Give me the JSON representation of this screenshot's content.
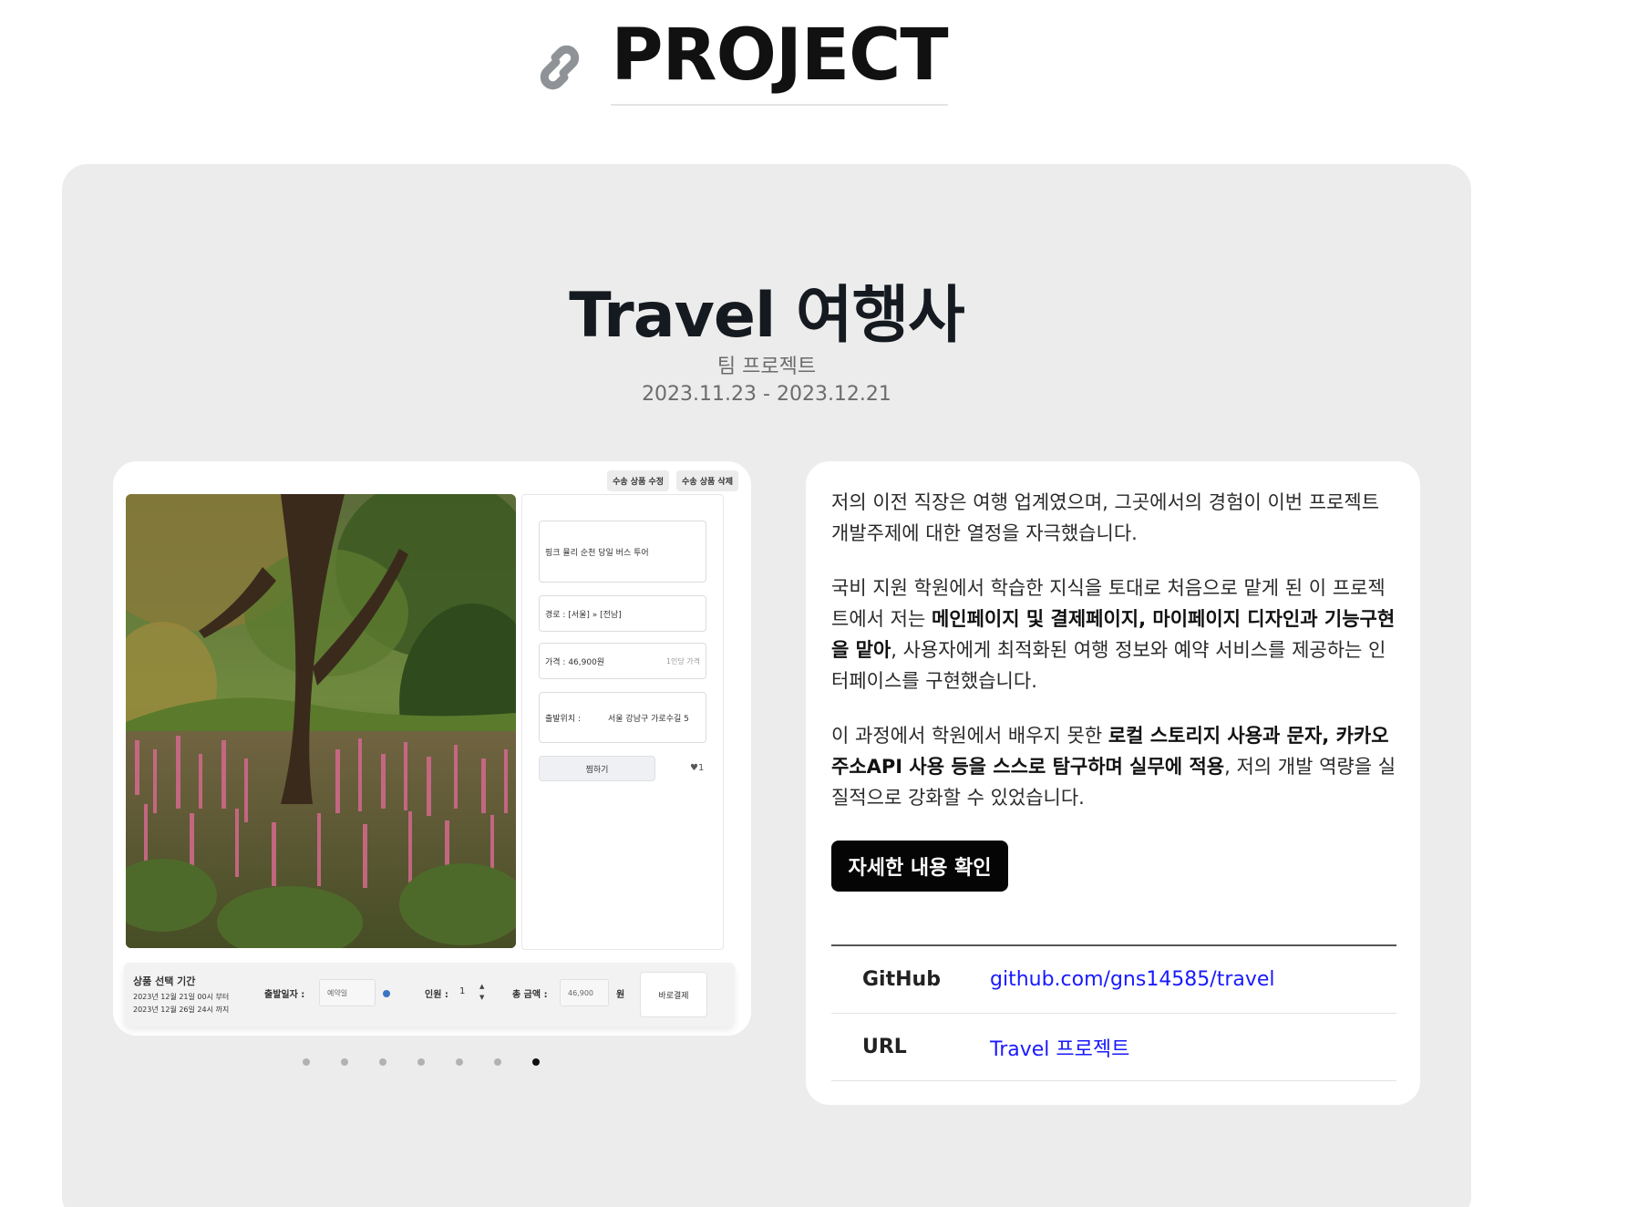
{
  "section": {
    "title": "PROJECT",
    "icon": "link-icon"
  },
  "project": {
    "title": "Travel 여행사",
    "kind": "팀 프로젝트",
    "period": "2023.11.23 - 2023.12.21"
  },
  "screenshot": {
    "top_buttons": [
      "수송 상품 수정",
      "수송 상품 삭제"
    ],
    "form": {
      "product_name": "핑크 뮬리 순천 당일 버스 투어",
      "route": "경로 : [서울] » [전남]",
      "price": "가격 : 46,900원",
      "price_hint": "1인당 가격",
      "departure_location_label": "출발위치 :",
      "departure_location_value": "서울 강남구 가로수길 5",
      "like_button": "찜하기",
      "like_count": "♥1"
    },
    "booking_bar": {
      "period_title": "상품 선택 기간",
      "period_start": "2023년 12월 21일 00시 부터",
      "period_end": "2023년 12월 26일 24시 까지",
      "date_label": "출발일자 :",
      "date_placeholder": "예약일",
      "people_label": "인원 :",
      "people_value": "1",
      "stepper_up": "▲",
      "stepper_down": "▼",
      "total_label": "총 금액 :",
      "total_value": "46,900",
      "currency": "원",
      "buy_button": "바로결제"
    },
    "slides_total": 7,
    "active_slide": 7
  },
  "description": {
    "p1": "저의 이전 직장은 여행 업계였으며, 그곳에서의 경험이 이번 프로젝트 개발주제에 대한 열정을 자극했습니다.",
    "p2_before": "국비 지원 학원에서 학습한 지식을 토대로 처음으로 맡게 된 이 프로젝트에서 저는 ",
    "p2_bold": "메인페이지 및 결제페이지, 마이페이지 디자인과 기능구현을 맡아",
    "p2_after": ", 사용자에게 최적화된 여행 정보와 예약 서비스를 제공하는 인터페이스를 구현했습니다.",
    "p3_before": "이 과정에서 학원에서 배우지 못한 ",
    "p3_bold": "로컬 스토리지 사용과 문자, 카카오 주소API 사용 등을 스스로 탐구하며 실무에 적용",
    "p3_after": ", 저의 개발 역량을 실질적으로 강화할 수 있었습니다.",
    "detail_button": "자세한 내용 확인"
  },
  "links": [
    {
      "key": "GitHub",
      "value": "github.com/gns14585/travel"
    },
    {
      "key": "URL",
      "value": "Travel 프로젝트"
    }
  ],
  "colors": {
    "card_bg": "#ececec",
    "panel_bg": "#ffffff",
    "link": "#1a1aff",
    "button_bg": "#050505"
  }
}
